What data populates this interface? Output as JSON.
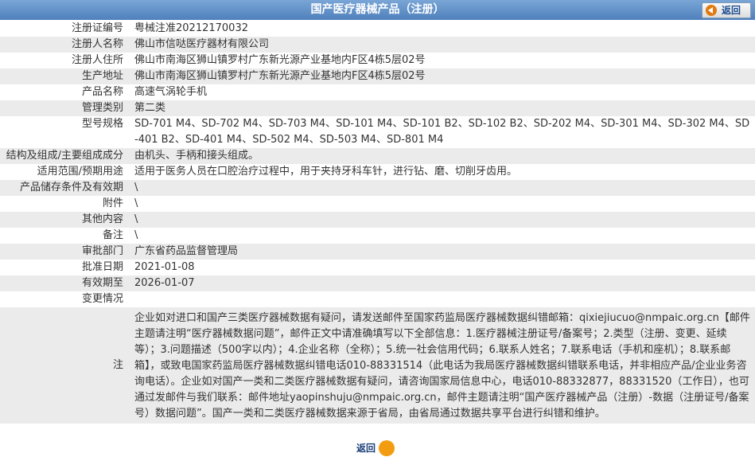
{
  "header": {
    "title": "国产医疗器械产品（注册）",
    "back_label": "返回"
  },
  "rows": [
    {
      "label": "注册证编号",
      "value": "粤械注准20212170032"
    },
    {
      "label": "注册人名称",
      "value": "佛山市信哒医疗器材有限公司"
    },
    {
      "label": "注册人住所",
      "value": "佛山市南海区狮山镇罗村广东新光源产业基地内F区4栋5层02号"
    },
    {
      "label": "生产地址",
      "value": "佛山市南海区狮山镇罗村广东新光源产业基地内F区4栋5层02号"
    },
    {
      "label": "产品名称",
      "value": "高速气涡轮手机"
    },
    {
      "label": "管理类别",
      "value": "第二类"
    },
    {
      "label": "型号规格",
      "value": "SD-701 M4、SD-702 M4、SD-703 M4、SD-101 M4、SD-101 B2、SD-102 B2、SD-202 M4、SD-301 M4、SD-302 M4、SD-401 B2、SD-401 M4、SD-502 M4、SD-503 M4、SD-801 M4"
    },
    {
      "label": "结构及组成/主要组成成分",
      "value": "由机头、手柄和接头组成。"
    },
    {
      "label": "适用范围/预期用途",
      "value": "适用于医务人员在口腔治疗过程中，用于夹持牙科车针，进行钻、磨、切削牙齿用。"
    },
    {
      "label": "产品储存条件及有效期",
      "value": "\\"
    },
    {
      "label": "附件",
      "value": "\\"
    },
    {
      "label": "其他内容",
      "value": "\\"
    },
    {
      "label": "备注",
      "value": "\\"
    },
    {
      "label": "审批部门",
      "value": "广东省药品监督管理局"
    },
    {
      "label": "批准日期",
      "value": "2021-01-08"
    },
    {
      "label": "有效期至",
      "value": "2026-01-07"
    },
    {
      "label": "变更情况",
      "value": ""
    }
  ],
  "note": {
    "label": "注",
    "value": "企业如对进口和国产三类医疗器械数据有疑问，请发送邮件至国家药监局医疗器械数据纠错邮箱：qixiejiucuo@nmpaic.org.cn【邮件主题请注明“医疗器械数据问题”，邮件正文中请准确填写以下全部信息：1.医疗器械注册证号/备案号；2.类型（注册、变更、延续等）；3.问题描述（500字以内）；4.企业名称（全称）；5.统一社会信用代码；6.联系人姓名；7.联系电话（手机和座机）；8.联系邮箱】，或致电国家药监局医疗器械数据纠错电话010-88331514（此电话为我局医疗器械数据纠错联系电话，并非相应产品/企业业务咨询电话）。企业如对国产一类和二类医疗器械数据有疑问，请咨询国家局信息中心，电话010-88332877，88331520（工作日），也可通过发邮件与我们联系：邮件地址yaopinshuju@nmpaic.org.cn，邮件主题请注明“国产医疗器械产品（注册）-数据（注册证号/备案号）数据问题”。国产一类和二类医疗器械数据来源于省局，由省局通过数据共享平台进行纠错和维护。"
  },
  "footer": {
    "back_label": "返回"
  }
}
